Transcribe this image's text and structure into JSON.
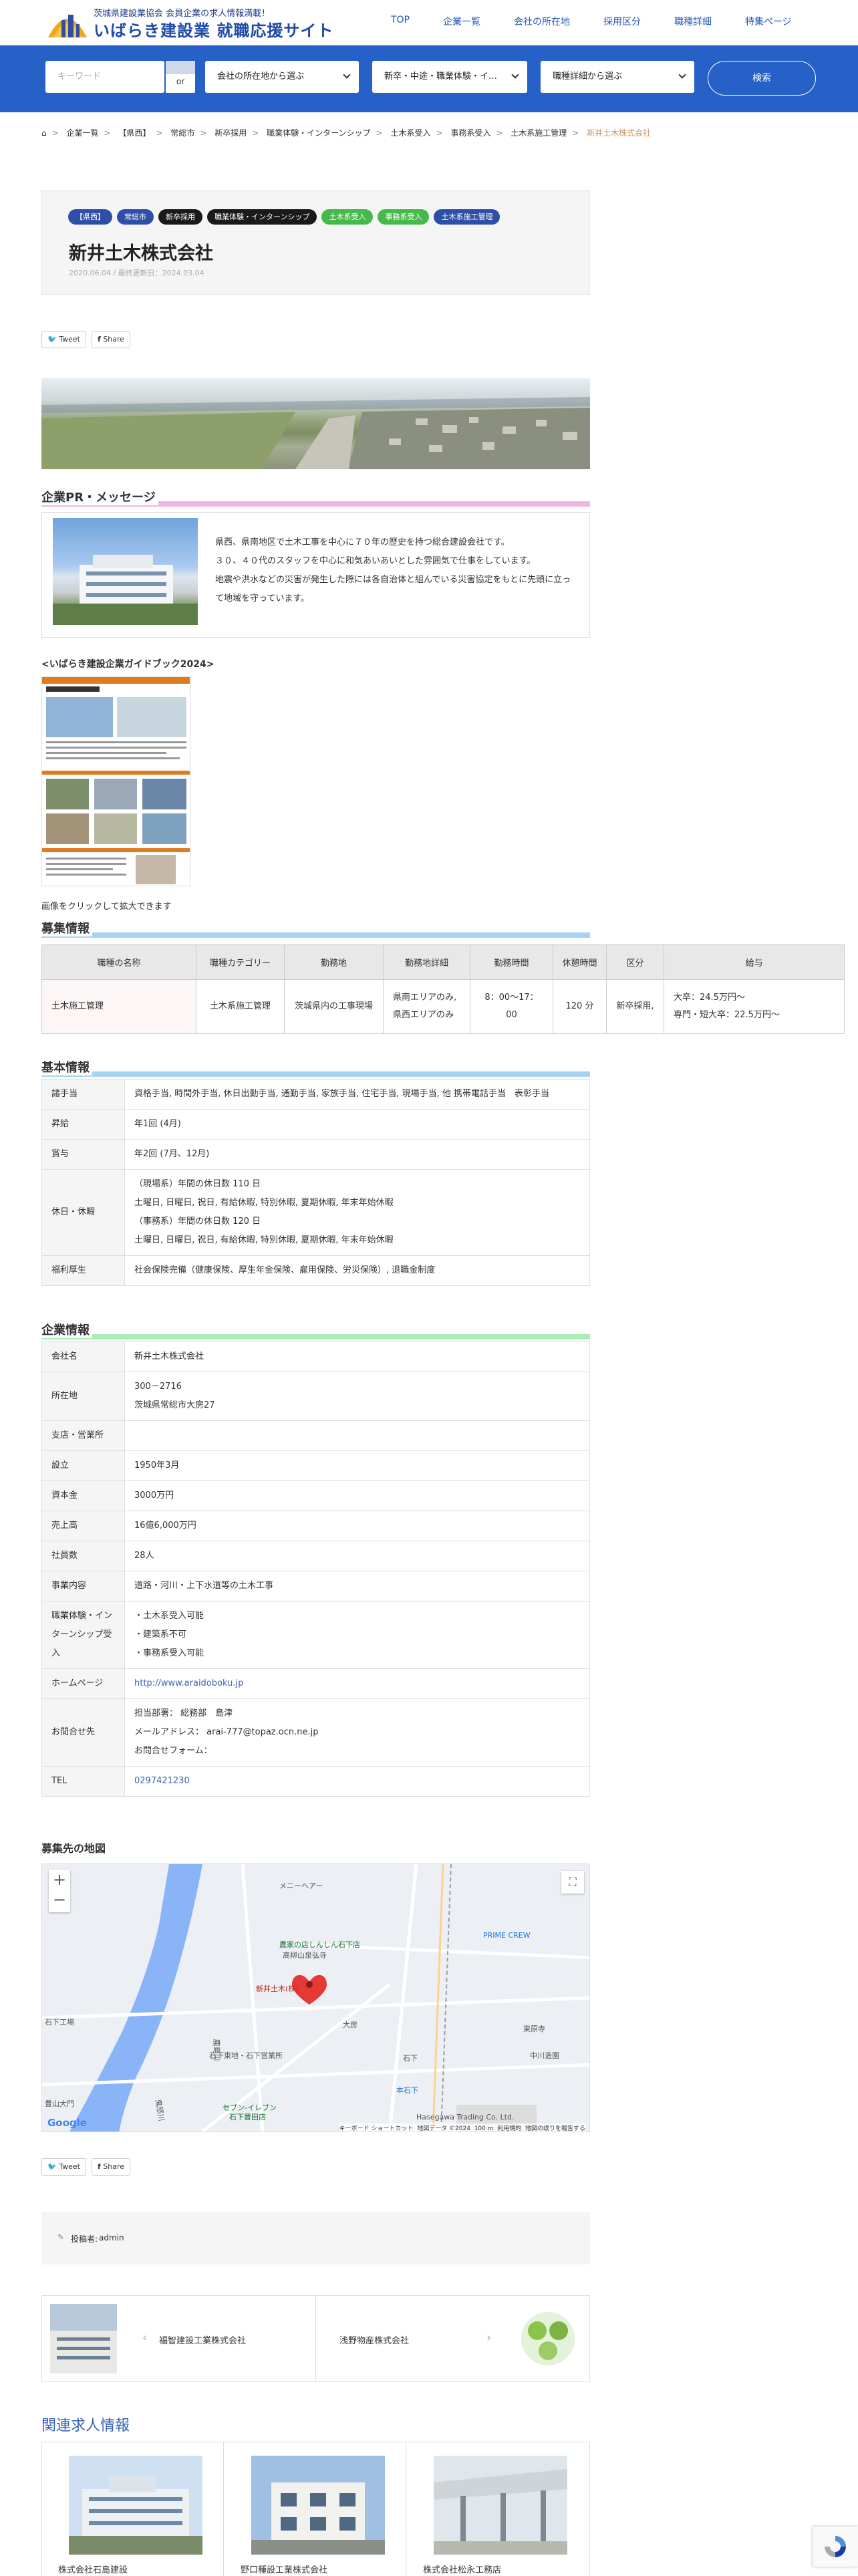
{
  "header": {
    "logo_sub": "茨城県建設業協会 会員企業の求人情報満載！",
    "logo_title": "いばらき建設業 就職応援サイト",
    "nav": [
      "TOP",
      "企業一覧",
      "会社の所在地",
      "採用区分",
      "職種詳細",
      "特集ページ"
    ]
  },
  "search": {
    "keyword_placeholder": "キーワード",
    "or_label": "or",
    "location_select": "会社の所在地から選ぶ",
    "category_select": "新卒・中途・職業体験・イ…",
    "detail_select": "職種詳細から選ぶ",
    "button": "検索"
  },
  "breadcrumb": [
    "企業一覧",
    "【県西】",
    "常総市",
    "新卒採用",
    "職業体験・インターンシップ",
    "土木系受入",
    "事務系受入",
    "土木系施工管理",
    "新井土木株式会社"
  ],
  "post": {
    "tags": [
      {
        "label": "【県西】",
        "color": "#2e4fa8"
      },
      {
        "label": "常総市",
        "color": "#2e4fa8"
      },
      {
        "label": "新卒採用",
        "color": "#1a1a1a"
      },
      {
        "label": "職業体験・インターンシップ",
        "color": "#1a1a1a"
      },
      {
        "label": "土木系受入",
        "color": "#46b94a"
      },
      {
        "label": "事務系受入",
        "color": "#46b94a"
      },
      {
        "label": "土木系施工管理",
        "color": "#2e4fa8"
      }
    ],
    "title": "新井土木株式会社",
    "date": "2020.06.04 / 最終更新日：2024.03.04"
  },
  "share": {
    "tweet": "Tweet",
    "facebook": "Share"
  },
  "pr": {
    "heading": "企業PR・メッセージ",
    "heading_color": "#f0b6e2",
    "lines": [
      "県西、県南地区で土木工事を中心に７０年の歴史を持つ総合建設会社です。",
      "３０、４０代のスタッフを中心に和気あいあいとした雰囲気で仕事をしています。",
      "地震や洪水などの災害が発生した際には各自治体と組んでいる災害協定をもとに先頭に立って地域を守っています。"
    ]
  },
  "guidebook": {
    "title": "<いばらき建設企業ガイドブック2024>",
    "caption": "画像をクリックして拡大できます",
    "img_company": "新井土木株式会社"
  },
  "recruit": {
    "heading": "募集情報",
    "heading_color": "#a7d3f2",
    "columns": [
      "職種の名称",
      "職種カテゴリー",
      "勤務地",
      "勤務地詳細",
      "勤務時間",
      "休憩時間",
      "区分",
      "給与"
    ],
    "row": [
      "土木施工管理",
      "土木系施工管理",
      "茨城県内の工事現場",
      "県南エリアのみ,\n県西エリアのみ",
      "8：00〜17：00",
      "120 分",
      "新卒採用,",
      "大卒：24.5万円〜\n専門・短大卒：22.5万円〜"
    ]
  },
  "basic": {
    "heading": "基本情報",
    "heading_color": "#a7d3f2",
    "rows": [
      {
        "k": "諸手当",
        "v": "資格手当, 時間外手当, 休日出勤手当, 通勤手当, 家族手当, 住宅手当, 現場手当, 他 携帯電話手当　表彰手当"
      },
      {
        "k": "昇給",
        "v": "年1回 (4月)"
      },
      {
        "k": "賞与",
        "v": "年2回 (7月、12月)"
      },
      {
        "k": "休日・休暇",
        "v": "（現場系）年間の休日数 110 日\n土曜日, 日曜日, 祝日, 有給休暇, 特別休暇, 夏期休暇, 年末年始休暇\n（事務系）年間の休日数 120 日\n土曜日, 日曜日, 祝日, 有給休暇, 特別休暇, 夏期休暇, 年末年始休暇"
      },
      {
        "k": "福利厚生",
        "v": "社会保険完備（健康保険、厚生年金保険、雇用保険、労災保険）, 退職金制度"
      }
    ]
  },
  "company": {
    "heading": "企業情報",
    "heading_color": "#a8efb5",
    "rows": [
      {
        "k": "会社名",
        "v": "新井土木株式会社"
      },
      {
        "k": "所在地",
        "v": "300－2716\n茨城県常総市大房27"
      },
      {
        "k": "支店・営業所",
        "v": ""
      },
      {
        "k": "設立",
        "v": "1950年3月"
      },
      {
        "k": "資本金",
        "v": "3000万円"
      },
      {
        "k": "売上高",
        "v": "16億6,000万円"
      },
      {
        "k": "社員数",
        "v": "28人"
      },
      {
        "k": "事業内容",
        "v": "道路・河川・上下水道等の土木工事"
      },
      {
        "k": "職業体験・インターンシップ受入",
        "v": "・土木系受入可能\n・建築系不可\n・事務系受入可能"
      },
      {
        "k": "ホームページ",
        "v": "http://www.araidoboku.jp",
        "link": true
      },
      {
        "k": "お問合せ先",
        "v": "担当部署： 総務部　島津\nメールアドレス： arai-777@topaz.ocn.ne.jp\nお問合せフォーム："
      },
      {
        "k": "TEL",
        "v": "0297421230",
        "link": true
      }
    ]
  },
  "map": {
    "heading": "募集先の地図",
    "labels": [
      "メニーヘアー",
      "PRIME CREW",
      "農家の店しんしん石下店",
      "高柳山泉弘寺",
      "新井土木(株)",
      "大房",
      "東原寺",
      "中川造園",
      "石下東地・石下営業所",
      "石下",
      "本石下",
      "セブン-イレブン",
      "石下豊田店",
      "Hasegawa Trading Co. Ltd.",
      "鹿島川",
      "鬼怒川",
      "石下工場",
      "豊山大門"
    ],
    "footer": [
      "キーボード ショートカット",
      "地図データ ©2024",
      "100 m",
      "利用規約",
      "地図の誤りを報告する"
    ],
    "google": "Google",
    "zoom_in": "+",
    "zoom_out": "−"
  },
  "author": {
    "label": "投稿者:",
    "name": "admin"
  },
  "postnav": {
    "prev": "福智建設工業株式会社",
    "next": "浅野物産株式会社"
  },
  "related": {
    "heading": "関連求人情報",
    "items": [
      "株式会社石島建設",
      "野口種設工業株式会社",
      "株式会社松永工務店"
    ]
  }
}
